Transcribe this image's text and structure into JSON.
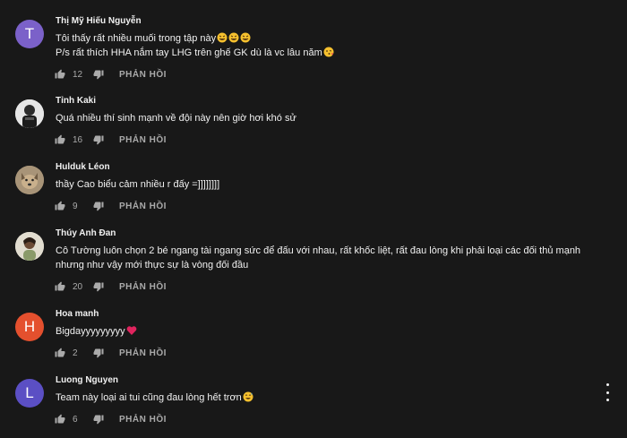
{
  "comments": [
    {
      "author": "Thị Mỹ Hiếu Nguyễn",
      "avatar_letter": "T",
      "avatar_color": "#7b61c9",
      "lines": [
        "Tôi thấy rất nhiều muối trong tập này",
        "P/s rất thích HHA nắm tay LHG trên ghế GK dù là vc lâu năm"
      ],
      "likes": "12",
      "reply_label": "PHẢN HỒI"
    },
    {
      "author": "Tỉnh Kaki",
      "avatar_icon": "person-photo-icon",
      "lines": [
        "Quá nhiều thí sinh mạnh về đội này nên giờ hơi khó sử"
      ],
      "likes": "16",
      "reply_label": "PHẢN HỒI"
    },
    {
      "author": "Hulduk Léon",
      "avatar_icon": "dog-photo-icon",
      "lines": [
        "thầy Cao biểu cảm nhiều r đấy =]]]]]]]]"
      ],
      "likes": "9",
      "reply_label": "PHẢN HỒI"
    },
    {
      "author": "Thúy Anh Đan",
      "avatar_icon": "person-photo-icon",
      "lines": [
        "Cô Tường luôn chọn 2 bé ngang tài ngang sức để đấu với nhau, rất khốc liệt, rất đau lòng khi phải loại các đối thủ mạnh",
        "nhưng như vậy mới thực sự là vòng đối đầu"
      ],
      "likes": "20",
      "reply_label": "PHẢN HỒI"
    },
    {
      "author": "Hoa manh",
      "avatar_letter": "H",
      "avatar_color": "#e4502e",
      "lines": [
        "Bigdayyyyyyyyy"
      ],
      "likes": "2",
      "reply_label": "PHẢN HỒI"
    },
    {
      "author": "Luong Nguyen",
      "avatar_letter": "L",
      "avatar_color": "#5b4fc4",
      "lines": [
        "Team này loại ai tui cũng đau lòng hết trơn"
      ],
      "likes": "6",
      "reply_label": "PHẢN HỒI"
    }
  ],
  "icons": {
    "like": "thumbs-up-icon",
    "dislike": "thumbs-down-icon",
    "emoji_laugh": "rofl-emoji-icon",
    "emoji_kiss": "kiss-emoji-icon",
    "emoji_heart": "red-heart-emoji-icon",
    "emoji_grin": "grin-sweat-emoji-icon",
    "menu": "more-vert-icon"
  }
}
